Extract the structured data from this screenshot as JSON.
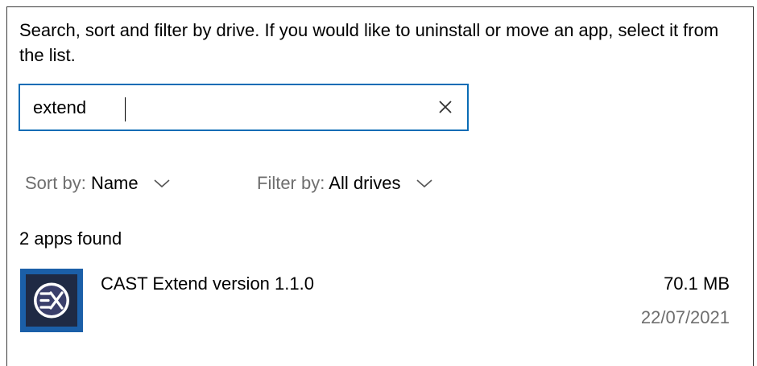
{
  "description": "Search, sort and filter by drive. If you would like to uninstall or move an app, select it from the list.",
  "search": {
    "value": "extend",
    "clear_icon": "close-icon"
  },
  "sort": {
    "label": "Sort by:",
    "value": "Name",
    "icon": "chevron-down-icon"
  },
  "filter": {
    "label": "Filter by:",
    "value": "All drives",
    "icon": "chevron-down-icon"
  },
  "results": {
    "count_text": "2 apps found"
  },
  "apps": [
    {
      "name": "CAST Extend version 1.1.0",
      "size": "70.1 MB",
      "date": "22/07/2021",
      "icon": "cast-extend-app-icon"
    }
  ],
  "colors": {
    "accent": "#0a6cb5",
    "secondary_text": "#6e6e6e",
    "app_icon_border": "#1b5fa8",
    "app_icon_fill": "#1f2a44"
  }
}
